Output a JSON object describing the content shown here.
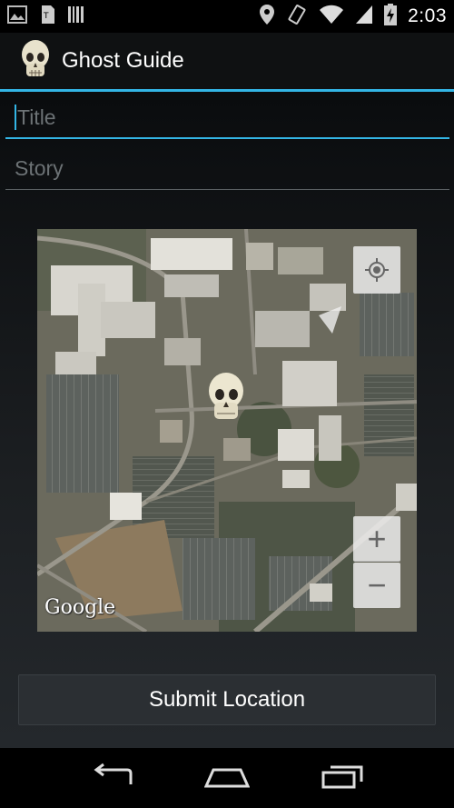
{
  "status_bar": {
    "time": "2:03",
    "left_icons": [
      "image-icon",
      "sim-card-icon",
      "barcode-icon"
    ],
    "right_icons": [
      "location-pin-icon",
      "vibrate-icon",
      "wifi-icon",
      "signal-icon",
      "battery-charging-icon"
    ]
  },
  "action_bar": {
    "title": "Ghost Guide",
    "icon": "skull-icon"
  },
  "form": {
    "title_placeholder": "Title",
    "story_placeholder": "Story"
  },
  "map": {
    "attribution": "Google",
    "zoom_in_label": "+",
    "zoom_out_label": "−",
    "marker_icon": "skull-icon",
    "locate_icon": "my-location-icon"
  },
  "submit_label": "Submit Location",
  "nav_bar": {
    "icons": [
      "back-icon",
      "home-icon",
      "recent-apps-icon"
    ]
  },
  "colors": {
    "accent": "#33b5e5",
    "background": "#111315"
  }
}
